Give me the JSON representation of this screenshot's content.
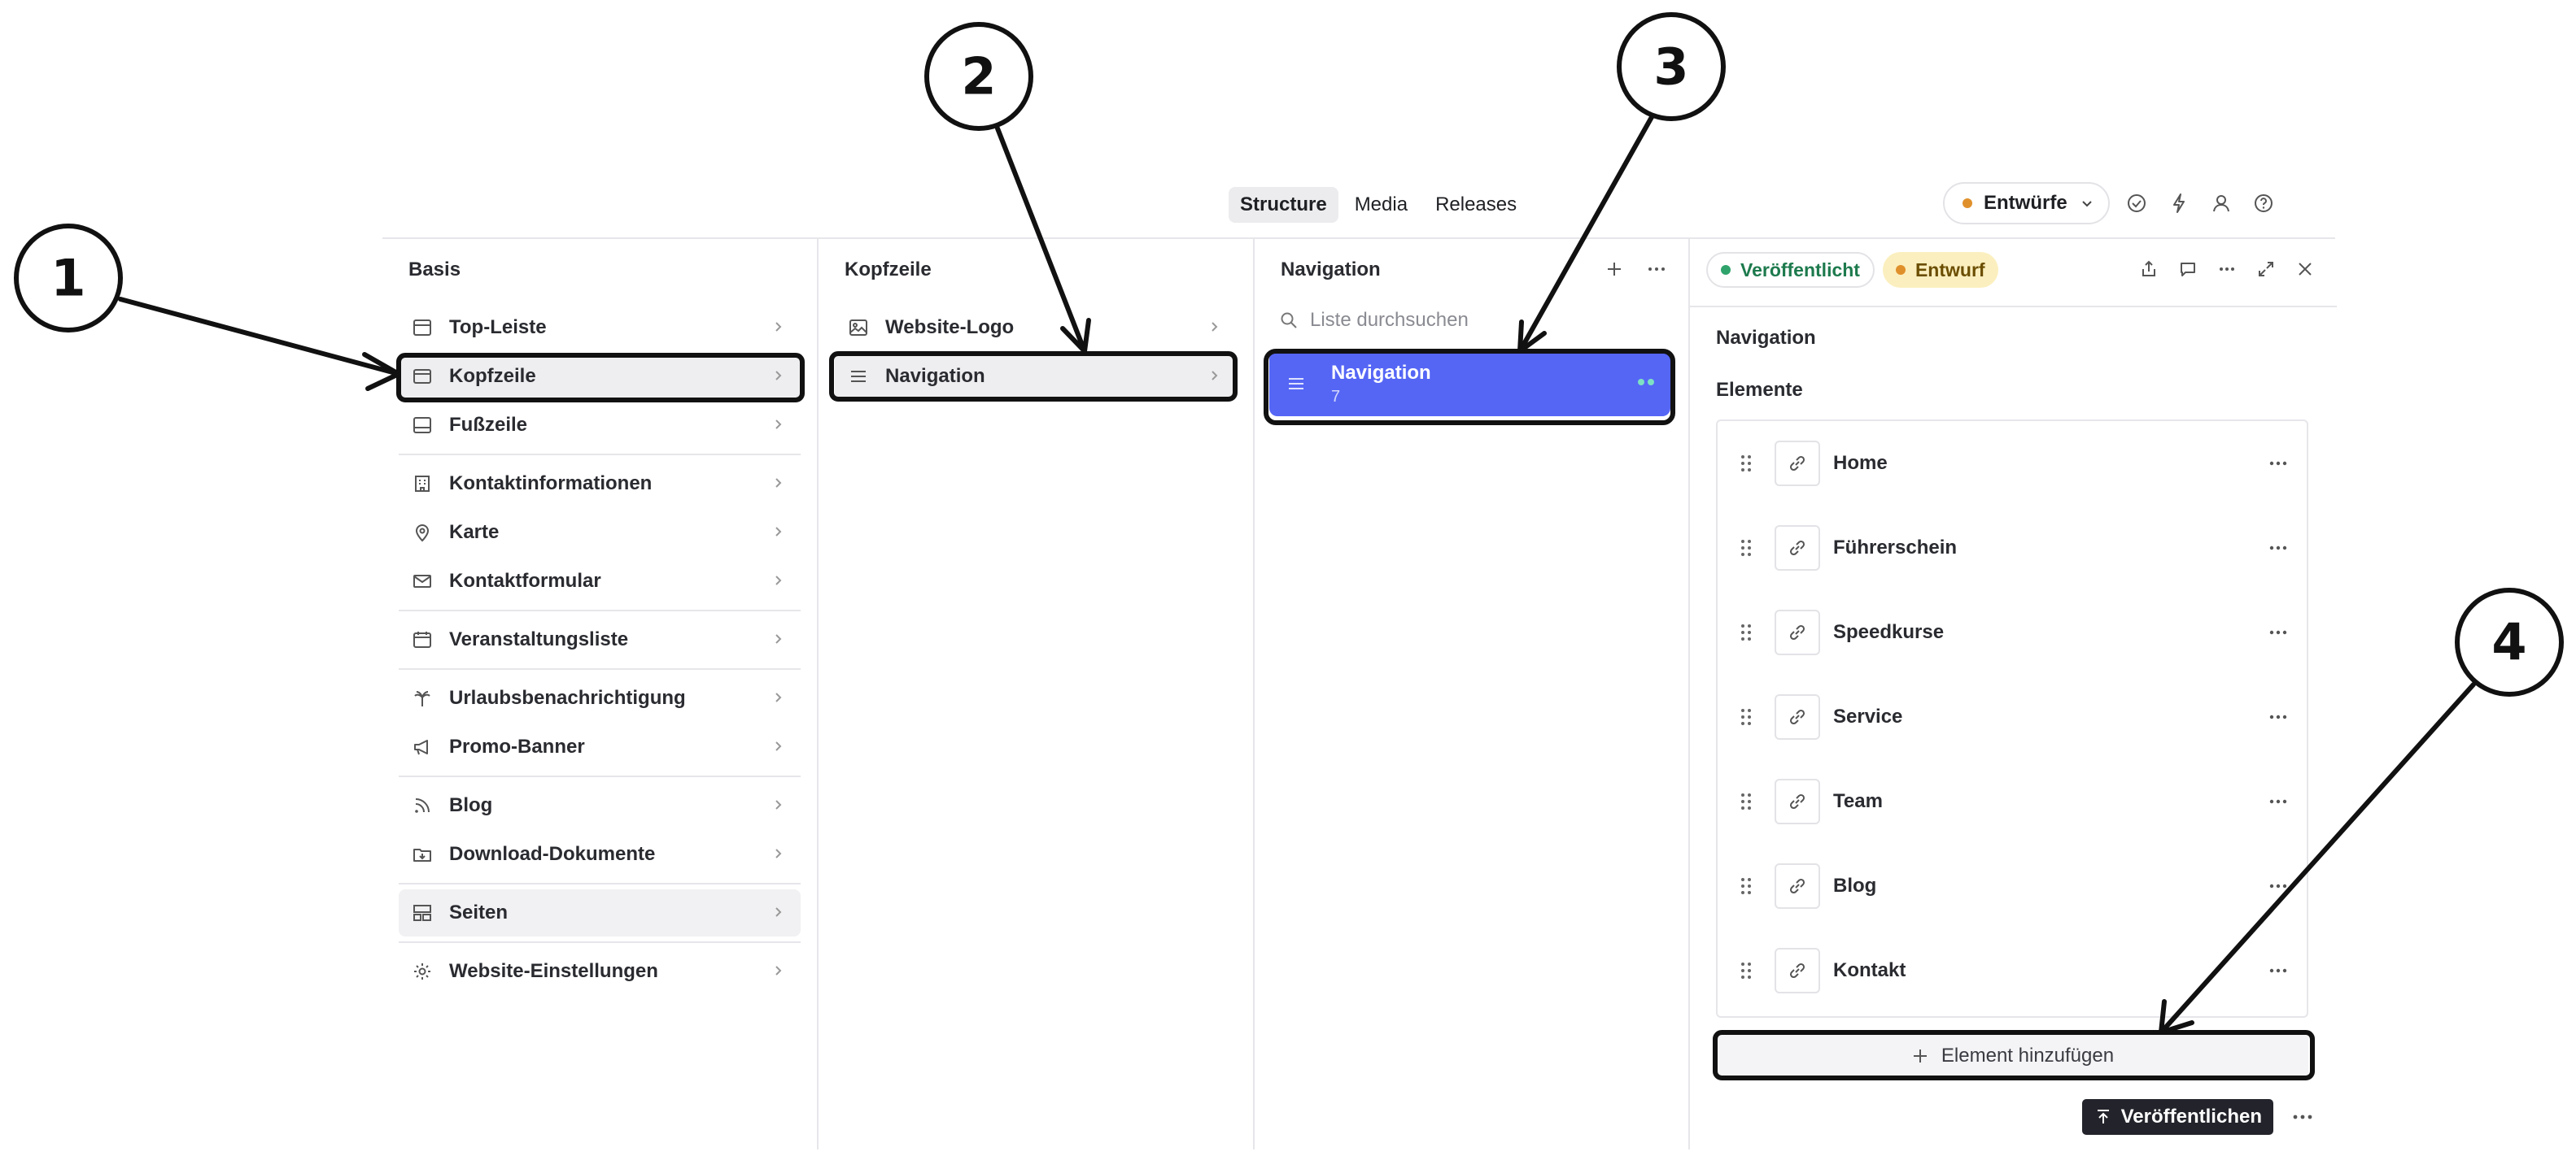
{
  "top": {
    "tabs": [
      {
        "label": "Structure",
        "active": true
      },
      {
        "label": "Media",
        "active": false
      },
      {
        "label": "Releases",
        "active": false
      }
    ],
    "perspective_label": "Entwürfe",
    "icons": [
      "check-circle-icon",
      "bolt-icon",
      "user-icon",
      "help-icon"
    ]
  },
  "pane1": {
    "title": "Basis",
    "items": [
      {
        "label": "Top-Leiste",
        "icon": "layout-top-icon"
      },
      {
        "label": "Kopfzeile",
        "icon": "window-icon",
        "selected": true
      },
      {
        "label": "Fußzeile",
        "icon": "layout-bottom-icon"
      },
      {
        "label": "Kontaktinformationen",
        "icon": "building-icon"
      },
      {
        "label": "Karte",
        "icon": "pin-icon"
      },
      {
        "label": "Kontaktformular",
        "icon": "envelope-icon"
      },
      {
        "label": "Veranstaltungsliste",
        "icon": "calendar-icon"
      },
      {
        "label": "Urlaubsbenachrichtigung",
        "icon": "palm-icon"
      },
      {
        "label": "Promo-Banner",
        "icon": "megaphone-icon"
      },
      {
        "label": "Blog",
        "icon": "rss-icon"
      },
      {
        "label": "Download-Dokumente",
        "icon": "folder-download-icon"
      },
      {
        "label": "Seiten",
        "icon": "layout-icon"
      },
      {
        "label": "Website-Einstellungen",
        "icon": "gear-icon"
      }
    ]
  },
  "pane2": {
    "title": "Kopfzeile",
    "items": [
      {
        "label": "Website-Logo",
        "icon": "image-icon"
      },
      {
        "label": "Navigation",
        "icon": "menu-icon",
        "selected": true
      }
    ]
  },
  "pane3": {
    "title": "Navigation",
    "search_placeholder": "Liste durchsuchen",
    "doc": {
      "title": "Navigation",
      "subtitle": "7"
    }
  },
  "pane4": {
    "badge_published": "Veröffentlicht",
    "badge_draft": "Entwurf",
    "field_title": "Navigation",
    "array_title": "Elemente",
    "elements": [
      "Home",
      "Führerschein",
      "Speedkurse",
      "Service",
      "Team",
      "Blog",
      "Kontakt"
    ],
    "add_label": "Element hinzufügen",
    "publish_label": "Veröffentlichen"
  },
  "annotations": [
    "1",
    "2",
    "3",
    "4"
  ],
  "colors": {
    "accent": "#5566f5",
    "published": "#2fa36b",
    "draft": "#e0902b",
    "draft_bg": "#fbefbf"
  }
}
